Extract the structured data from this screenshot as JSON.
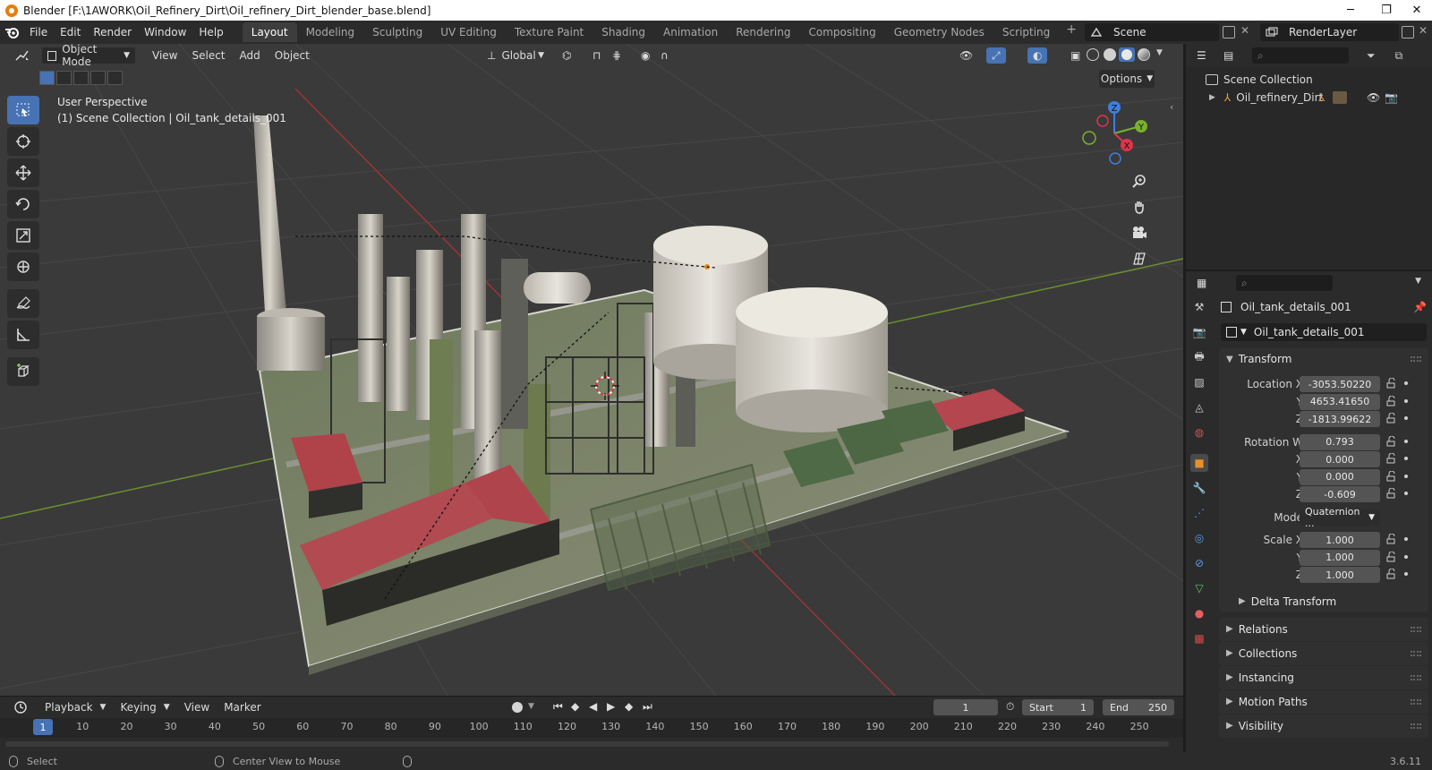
{
  "window": {
    "title": "Blender [F:\\1AWORK\\Oil_Refinery_Dirt\\Oil_refinery_Dirt_blender_base.blend]",
    "min_glyph": "─",
    "max_glyph": "❐",
    "close_glyph": "✕"
  },
  "menu": [
    "File",
    "Edit",
    "Render",
    "Window",
    "Help"
  ],
  "workspaces": [
    "Layout",
    "Modeling",
    "Sculpting",
    "UV Editing",
    "Texture Paint",
    "Shading",
    "Animation",
    "Rendering",
    "Compositing",
    "Geometry Nodes",
    "Scripting"
  ],
  "workspace_add": "+",
  "scene": {
    "name": "Scene",
    "layer": "RenderLayer"
  },
  "viewport": {
    "mode": "Object Mode",
    "menus": [
      "View",
      "Select",
      "Add",
      "Object"
    ],
    "orientation": "Global",
    "options": "Options",
    "perspective": "User Perspective",
    "collection_info": "(1) Scene Collection | Oil_tank_details_001",
    "gizmo": {
      "x": "X",
      "y": "Y",
      "z": "Z"
    }
  },
  "outliner": {
    "root": "Scene Collection",
    "items": [
      {
        "name": "Oil_refinery_Dirt"
      }
    ]
  },
  "properties": {
    "object_name": "Oil_tank_details_001",
    "data_name": "Oil_tank_details_001",
    "transform": {
      "title": "Transform",
      "location": [
        {
          "label": "Location X",
          "value": "-3053.50220"
        },
        {
          "label": "Y",
          "value": "4653.41650"
        },
        {
          "label": "Z",
          "value": "-1813.99622"
        }
      ],
      "rotation": [
        {
          "label": "Rotation W",
          "value": "0.793"
        },
        {
          "label": "X",
          "value": "0.000"
        },
        {
          "label": "Y",
          "value": "0.000"
        },
        {
          "label": "Z",
          "value": "-0.609"
        }
      ],
      "mode_label": "Mode",
      "mode_value": "Quaternion ...",
      "scale": [
        {
          "label": "Scale X",
          "value": "1.000"
        },
        {
          "label": "Y",
          "value": "1.000"
        },
        {
          "label": "Z",
          "value": "1.000"
        }
      ],
      "delta": "Delta Transform"
    },
    "sections": [
      "Relations",
      "Collections",
      "Instancing",
      "Motion Paths",
      "Visibility"
    ]
  },
  "timeline": {
    "menus": [
      "Playback",
      "Keying",
      "View",
      "Marker"
    ],
    "current_frame": "1",
    "frame_field": "1",
    "start_label": "Start",
    "start_value": "1",
    "end_label": "End",
    "end_value": "250",
    "ticks": [
      "10",
      "20",
      "30",
      "40",
      "50",
      "60",
      "70",
      "80",
      "90",
      "100",
      "110",
      "120",
      "130",
      "140",
      "150",
      "160",
      "170",
      "180",
      "190",
      "200",
      "210",
      "220",
      "230",
      "240",
      "250"
    ]
  },
  "status": {
    "left": "Select",
    "middle": "Center View to Mouse",
    "version": "3.6.11"
  }
}
